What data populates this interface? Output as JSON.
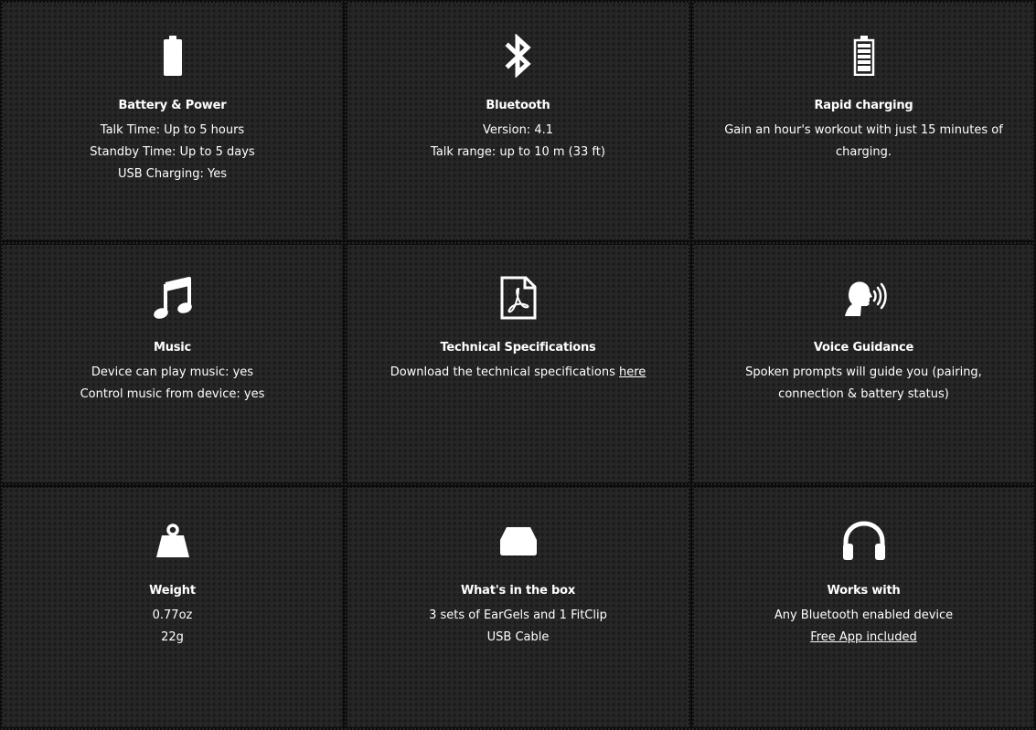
{
  "cards": [
    {
      "icon": "battery-icon",
      "title": "Battery & Power",
      "lines": [
        "Talk Time: Up to 5 hours",
        "Standby Time: Up to 5 days",
        "USB Charging: Yes"
      ]
    },
    {
      "icon": "bluetooth-icon",
      "title": "Bluetooth",
      "lines": [
        "Version: 4.1",
        "Talk range: up to 10 m (33 ft)"
      ]
    },
    {
      "icon": "battery-charging-icon",
      "title": "Rapid charging",
      "lines": [
        "Gain an hour's workout with just 15 minutes of",
        "charging."
      ]
    },
    {
      "icon": "music-note-icon",
      "title": "Music",
      "lines": [
        "Device can play music: yes",
        "Control music from device: yes"
      ]
    },
    {
      "icon": "pdf-document-icon",
      "title": "Technical Specifications",
      "line_prefix": "Download the technical specifications ",
      "link_text": "here"
    },
    {
      "icon": "voice-speaking-icon",
      "title": "Voice Guidance",
      "lines": [
        "Spoken prompts will guide you (pairing,",
        "connection & battery status)"
      ]
    },
    {
      "icon": "weight-icon",
      "title": "Weight",
      "lines": [
        "0.77oz",
        "22g"
      ]
    },
    {
      "icon": "box-icon",
      "title": "What's in the box",
      "lines": [
        "3 sets of EarGels and 1 FitClip",
        "USB Cable"
      ]
    },
    {
      "icon": "headphones-icon",
      "title": "Works with",
      "lines": [
        "Any Bluetooth enabled device"
      ],
      "link_text": "Free App included"
    }
  ]
}
